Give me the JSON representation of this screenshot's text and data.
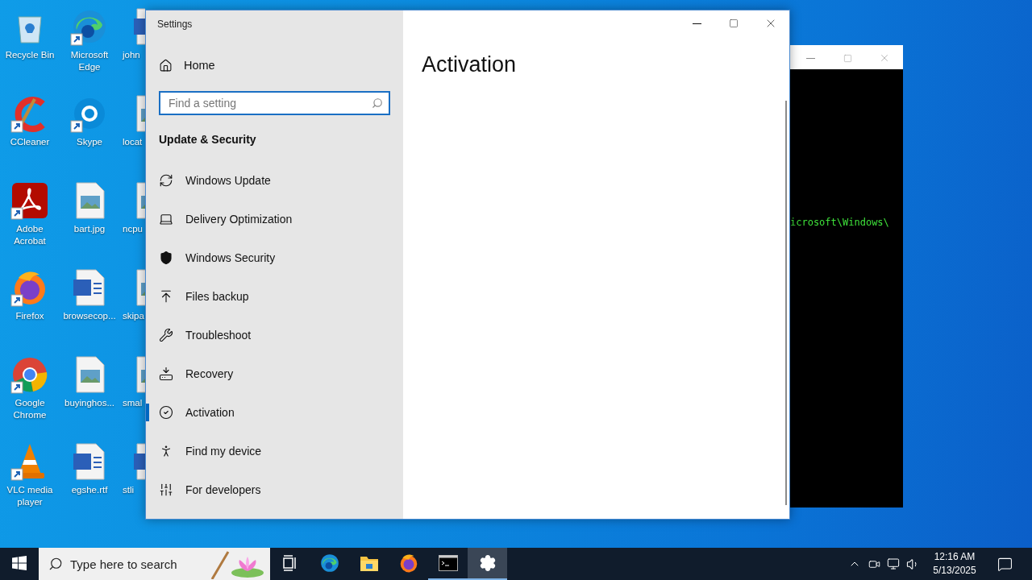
{
  "desktop": {
    "icons": [
      {
        "label": "Recycle Bin",
        "kind": "recycle",
        "shortcut": false
      },
      {
        "label": "Microsoft Edge",
        "kind": "edge",
        "shortcut": true
      },
      {
        "label": "john",
        "kind": "word",
        "shortcut": false
      },
      {
        "label": "CCleaner",
        "kind": "ccleaner",
        "shortcut": true
      },
      {
        "label": "Skype",
        "kind": "skype",
        "shortcut": true
      },
      {
        "label": "locat",
        "kind": "image",
        "shortcut": false
      },
      {
        "label": "Adobe Acrobat",
        "kind": "acrobat",
        "shortcut": true
      },
      {
        "label": "bart.jpg",
        "kind": "image",
        "shortcut": false
      },
      {
        "label": "ncpu",
        "kind": "image",
        "shortcut": false
      },
      {
        "label": "Firefox",
        "kind": "firefox",
        "shortcut": true
      },
      {
        "label": "browsecop...",
        "kind": "word",
        "shortcut": false
      },
      {
        "label": "skipa",
        "kind": "image",
        "shortcut": false
      },
      {
        "label": "Google Chrome",
        "kind": "chrome",
        "shortcut": true
      },
      {
        "label": "buyinghos...",
        "kind": "image",
        "shortcut": false
      },
      {
        "label": "smal",
        "kind": "image",
        "shortcut": false
      },
      {
        "label": "VLC media player",
        "kind": "vlc",
        "shortcut": true
      },
      {
        "label": "egshe.rtf",
        "kind": "word",
        "shortcut": false
      },
      {
        "label": "stli",
        "kind": "word",
        "shortcut": false
      }
    ]
  },
  "console": {
    "line": "icrosoft\\Windows\\"
  },
  "settings": {
    "title": "Settings",
    "home": "Home",
    "search": {
      "placeholder": "Find a setting"
    },
    "section": "Update & Security",
    "nav": [
      {
        "label": "Windows Update",
        "kind": "update",
        "selected": false
      },
      {
        "label": "Delivery Optimization",
        "kind": "delivery",
        "selected": false
      },
      {
        "label": "Windows Security",
        "kind": "shield",
        "selected": false
      },
      {
        "label": "Files backup",
        "kind": "backup",
        "selected": false
      },
      {
        "label": "Troubleshoot",
        "kind": "wrench",
        "selected": false
      },
      {
        "label": "Recovery",
        "kind": "recovery",
        "selected": false
      },
      {
        "label": "Activation",
        "kind": "activation",
        "selected": true
      },
      {
        "label": "Find my device",
        "kind": "find",
        "selected": false
      },
      {
        "label": "For developers",
        "kind": "developers",
        "selected": false
      }
    ],
    "page_title": "Activation"
  },
  "taskbar": {
    "search": {
      "placeholder": "Type here to search"
    },
    "apps": [
      {
        "kind": "taskview",
        "running": false,
        "selected": false
      },
      {
        "kind": "edge",
        "running": false,
        "selected": false
      },
      {
        "kind": "explorer",
        "running": false,
        "selected": false
      },
      {
        "kind": "firefox",
        "running": false,
        "selected": false
      },
      {
        "kind": "terminal",
        "running": true,
        "selected": false
      },
      {
        "kind": "settings",
        "running": true,
        "selected": true
      }
    ],
    "time": "12:16 AM",
    "date": "5/13/2025"
  }
}
